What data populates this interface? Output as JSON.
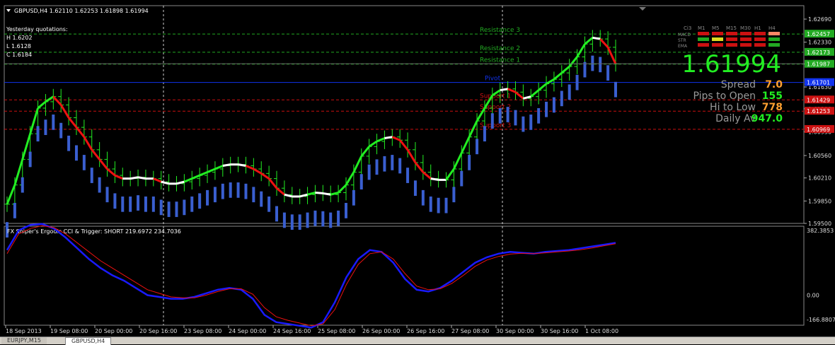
{
  "chart_data": [
    {
      "type": "candlestick",
      "title": "GBPUSD,H4  1.62110 1.62253 1.61898 1.61994",
      "ylim": [
        1.595,
        1.629
      ],
      "y_ticks": [
        "1.62690",
        "1.62330",
        "1.61990",
        "1.61630",
        "1.61290",
        "1.60930",
        "1.60560",
        "1.60210",
        "1.59850",
        "1.59500"
      ],
      "x_tick_labels": [
        "18 Sep 2013",
        "19 Sep 08:00",
        "20 Sep 00:00",
        "20 Sep 16:00",
        "23 Sep 08:00",
        "24 Sep 00:00",
        "24 Sep 16:00",
        "25 Sep 08:00",
        "26 Sep 00:00",
        "26 Sep 16:00",
        "27 Sep 08:00",
        "30 Sep 00:00",
        "30 Sep 16:00",
        "1 Oct 08:00"
      ],
      "close": [
        1.598,
        1.601,
        1.605,
        1.609,
        1.613,
        1.614,
        1.6148,
        1.6135,
        1.6115,
        1.61,
        1.6085,
        1.6065,
        1.605,
        1.6035,
        1.6025,
        1.602,
        1.602,
        1.6022,
        1.602,
        1.602,
        1.6015,
        1.6012,
        1.6012,
        1.6015,
        1.602,
        1.6025,
        1.603,
        1.6035,
        1.604,
        1.6042,
        1.6042,
        1.604,
        1.6035,
        1.6028,
        1.602,
        1.6005,
        1.5995,
        1.5992,
        1.5992,
        1.5995,
        1.5998,
        1.5997,
        1.5995,
        1.5998,
        1.601,
        1.603,
        1.6055,
        1.607,
        1.6078,
        1.6083,
        1.6085,
        1.608,
        1.6065,
        1.6045,
        1.603,
        1.602,
        1.6018,
        1.6018,
        1.6035,
        1.606,
        1.6085,
        1.611,
        1.613,
        1.615,
        1.6158,
        1.616,
        1.6155,
        1.6145,
        1.6148,
        1.6158,
        1.6168,
        1.6175,
        1.6185,
        1.6195,
        1.621,
        1.623,
        1.624,
        1.6238,
        1.6225,
        1.6199
      ],
      "levels": [
        {
          "name": "Resistance 3",
          "value": 1.62457,
          "color": "#22aa22"
        },
        {
          "name": "Resistance 2",
          "value": 1.62173,
          "color": "#22aa22"
        },
        {
          "name": "Resistance 1",
          "value": 1.61987,
          "color": "#22aa22"
        },
        {
          "name": "Pivot",
          "value": 1.61701,
          "color": "#1133ee"
        },
        {
          "name": "Support 1",
          "value": 1.61429,
          "color": "#cc1111"
        },
        {
          "name": "Support 2",
          "value": 1.61253,
          "color": "#cc1111"
        },
        {
          "name": "Support 3",
          "value": 1.60969,
          "color": "#cc1111"
        }
      ],
      "level_labels": [
        "1.62457",
        "1.62173",
        "1.61987",
        "1.61701",
        "1.61429",
        "1.61253",
        "1.60969"
      ],
      "current_price_label": "1.61994",
      "yesterday": {
        "heading": "Yesterday quotations:",
        "high": "H 1.6202",
        "low": "L 1.6128",
        "close": "C 1.6184"
      },
      "info_panel": {
        "price": "1.61994",
        "rows": [
          {
            "label": "Spread",
            "value": "7.0",
            "value_color": "#ffa030"
          },
          {
            "label": "Pips to Open",
            "value": "155",
            "value_color": "#22ee22"
          },
          {
            "label": "Hi to Low",
            "value": "778",
            "value_color": "#ffa030"
          },
          {
            "label": "Daily Av",
            "value": "947.0",
            "value_color": "#22ee22"
          }
        ],
        "signal_headers": [
          "Ci3",
          "M1",
          "M5",
          "M15",
          "M30",
          "H1",
          "H4"
        ],
        "signal_rows": [
          {
            "name": "MACD",
            "colors": [
              "#cc1111",
              "#cc1111",
              "#cc1111",
              "#cc1111",
              "#cc1111",
              "#ff8866"
            ]
          },
          {
            "name": "STR",
            "colors": [
              "#22aa22",
              "#dddd22",
              "#cc1111",
              "#cc1111",
              "#cc1111",
              "#22aa22"
            ]
          },
          {
            "name": "EMA",
            "colors": [
              "#cc1111",
              "#cc1111",
              "#cc1111",
              "#cc1111",
              "#cc1111",
              "#22aa22"
            ]
          }
        ]
      }
    },
    {
      "type": "line",
      "title": "FX Sniper's Ergodic CCI & Trigger: SHORT 219.6972 234.7036",
      "ylim": [
        -166.8807,
        382.3853
      ],
      "y_ticks": [
        "382.3853",
        "0.00",
        "-166.8807"
      ],
      "series": [
        {
          "name": "CCI",
          "color": "#1a1aff",
          "values": [
            250,
            360,
            390,
            395,
            370,
            320,
            260,
            200,
            150,
            110,
            80,
            40,
            0,
            -10,
            -20,
            -20,
            -10,
            10,
            30,
            40,
            30,
            -20,
            -110,
            -150,
            -160,
            -170,
            -180,
            -150,
            -40,
            100,
            200,
            250,
            240,
            180,
            90,
            30,
            20,
            40,
            80,
            130,
            180,
            210,
            230,
            240,
            235,
            230,
            240,
            245,
            250,
            260,
            270,
            280,
            290
          ]
        },
        {
          "name": "Trigger",
          "color": "#ee1111",
          "values": [
            230,
            340,
            370,
            385,
            375,
            340,
            290,
            240,
            190,
            150,
            110,
            70,
            30,
            10,
            -10,
            -15,
            -15,
            0,
            20,
            35,
            35,
            5,
            -70,
            -120,
            -140,
            -155,
            -170,
            -160,
            -80,
            60,
            170,
            230,
            240,
            200,
            120,
            50,
            30,
            35,
            65,
            110,
            160,
            195,
            215,
            228,
            232,
            230,
            235,
            240,
            245,
            252,
            262,
            274,
            285
          ]
        }
      ]
    }
  ],
  "tabs": [
    "EURJPY,M15",
    "GBPUSD,H4"
  ]
}
